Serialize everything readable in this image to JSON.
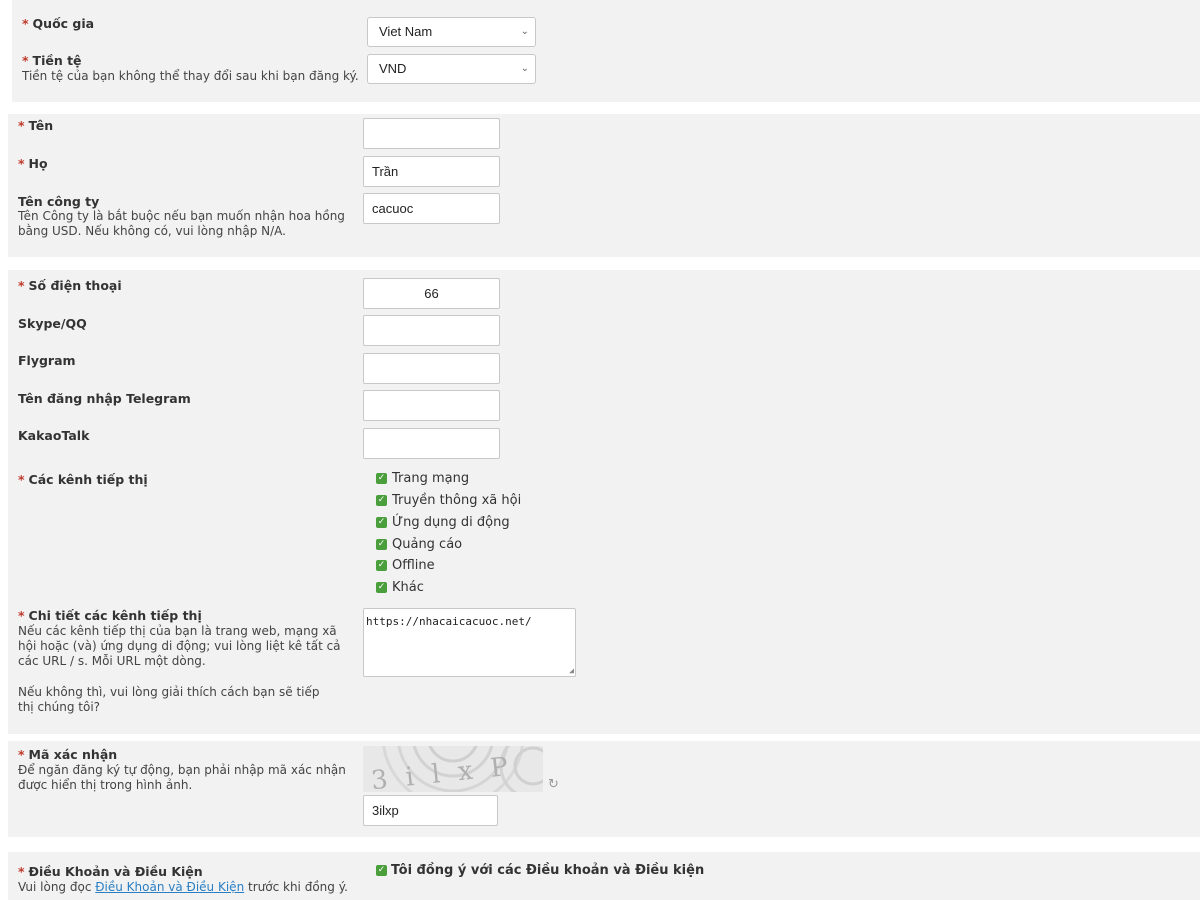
{
  "country": {
    "label": "Quốc gia",
    "value": "Viet Nam"
  },
  "currency": {
    "label": "Tiền tệ",
    "hint": "Tiền tệ của bạn không thể thay đổi sau khi bạn đăng ký.",
    "value": "VND"
  },
  "first_name": {
    "label": "Tên",
    "value": ""
  },
  "last_name": {
    "label": "Họ",
    "value": "Trần"
  },
  "company": {
    "label": "Tên công ty",
    "hint": "Tên Công ty là bắt buộc nếu bạn muốn nhận hoa hồng bằng USD. Nếu không có, vui lòng nhập N/A.",
    "value": "cacuoc"
  },
  "phone": {
    "label": "Số điện thoại",
    "value": "66"
  },
  "skype": {
    "label": "Skype/QQ",
    "value": ""
  },
  "flygram": {
    "label": "Flygram",
    "value": ""
  },
  "telegram": {
    "label": "Tên đăng nhập Telegram",
    "value": ""
  },
  "kakao": {
    "label": "KakaoTalk",
    "value": ""
  },
  "channels": {
    "label": "Các kênh tiếp thị",
    "options": [
      {
        "label": "Trang mạng",
        "checked": true
      },
      {
        "label": "Truyền thông xã hội",
        "checked": true
      },
      {
        "label": "Ứng dụng di động",
        "checked": true
      },
      {
        "label": "Quảng cáo",
        "checked": true
      },
      {
        "label": "Offline",
        "checked": true
      },
      {
        "label": "Khác",
        "checked": true
      }
    ]
  },
  "channel_details": {
    "label": "Chi tiết các kênh tiếp thị",
    "hint1": "Nếu các kênh tiếp thị của bạn là trang web, mạng xã hội hoặc (và) ứng dụng di động; vui lòng liệt kê tất cả các URL / s. Mỗi URL một dòng.",
    "hint2": "Nếu không thì, vui lòng giải thích cách bạn sẽ tiếp thị chúng tôi?",
    "value": "https://nhacaicacuoc.net/"
  },
  "captcha": {
    "label": "Mã xác nhận",
    "hint": "Để ngăn đăng ký tự động, bạn phải nhập mã xác nhận được hiển thị trong hình ảnh.",
    "image_text": "3ilxP",
    "value": "3ilxp"
  },
  "terms": {
    "label": "Điều Khoản và Điều Kiện",
    "hint_prefix": "Vui lòng đọc",
    "link_text": "Điều Khoản và Điều Kiện",
    "hint_suffix": "trước khi đồng ý.",
    "agree_label": "Tôi đồng ý với các Điều khoản và Điều kiện",
    "checked": true
  },
  "required_mark": "*"
}
